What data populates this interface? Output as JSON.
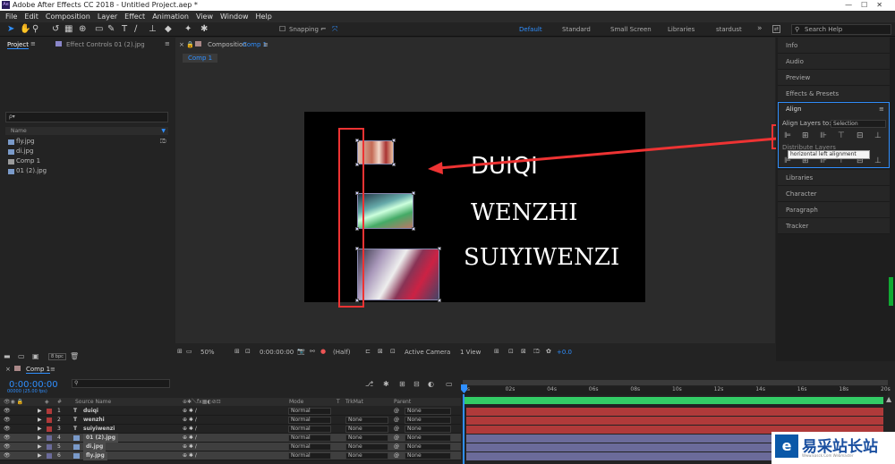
{
  "app": {
    "title": "Adobe After Effects CC 2018 - Untitled Project.aep *",
    "icon": "Ae"
  },
  "menu": [
    "File",
    "Edit",
    "Composition",
    "Layer",
    "Effect",
    "Animation",
    "View",
    "Window",
    "Help"
  ],
  "toolbar": {
    "snapping": "Snapping",
    "workspaces": [
      "Default",
      "Standard",
      "Small Screen",
      "Libraries",
      "stardust"
    ],
    "search_placeholder": "Search Help"
  },
  "project": {
    "tab": "Project",
    "effect_tab": "Effect Controls 01 (2).jpg",
    "search_placeholder": "ρ▾",
    "name_header": "Name",
    "bpc": "8 bpc",
    "items": [
      {
        "name": "fly.jpg",
        "type": "image"
      },
      {
        "name": "di.jpg",
        "type": "image"
      },
      {
        "name": "Comp 1",
        "type": "comp"
      },
      {
        "name": "01 (2).jpg",
        "type": "image"
      }
    ]
  },
  "composition": {
    "tab_prefix": "Composition",
    "tab_name": "Comp 1",
    "flow_tab": "Comp 1",
    "texts": [
      "DUIQI",
      "WENZHI",
      "SUIYIWENZI"
    ],
    "footer": {
      "zoom": "50%",
      "timecode": "0:00:00:00",
      "resolution": "(Half)",
      "camera": "Active Camera",
      "view": "1 View",
      "exposure": "+0.0"
    }
  },
  "right_panels": [
    "Info",
    "Audio",
    "Preview",
    "Effects & Presets",
    "Align",
    "Libraries",
    "Character",
    "Paragraph",
    "Tracker"
  ],
  "align": {
    "title": "Align",
    "align_layers_to": "Align Layers to:",
    "selection": "Selection",
    "distribute": "Distribute Layers",
    "tooltip": "horizontal left alignment"
  },
  "timeline": {
    "tab": "Comp 1",
    "timecode": "0:00:00:00",
    "fps": "00000 (25.00 fps)",
    "columns": {
      "num": "#",
      "source": "Source Name",
      "mode": "Mode",
      "t": "T",
      "trkmat": "TrkMat",
      "parent": "Parent"
    },
    "ruler": [
      "0s",
      "02s",
      "04s",
      "06s",
      "08s",
      "10s",
      "12s",
      "14s",
      "16s",
      "18s",
      "20s"
    ],
    "layers": [
      {
        "num": "1",
        "type": "T",
        "name": "duiqi",
        "mode": "Normal",
        "trkmat": "",
        "parent": "None",
        "color": "#b03a3a"
      },
      {
        "num": "2",
        "type": "T",
        "name": "wenzhi",
        "mode": "Normal",
        "trkmat": "None",
        "parent": "None",
        "color": "#b03a3a"
      },
      {
        "num": "3",
        "type": "T",
        "name": "suiyiwenzi",
        "mode": "Normal",
        "trkmat": "None",
        "parent": "None",
        "color": "#b03a3a"
      },
      {
        "num": "4",
        "type": "img",
        "name": "01 (2).jpg",
        "mode": "Normal",
        "trkmat": "None",
        "parent": "None",
        "color": "#6b6b9a"
      },
      {
        "num": "5",
        "type": "img",
        "name": "di.jpg",
        "mode": "Normal",
        "trkmat": "None",
        "parent": "None",
        "color": "#6b6b9a"
      },
      {
        "num": "6",
        "type": "img",
        "name": "fly.jpg",
        "mode": "Normal",
        "trkmat": "None",
        "parent": "None",
        "color": "#6b6b9a"
      }
    ]
  },
  "watermark": {
    "text": "易采站长站",
    "sub": "Www.Easck.Com Webmaster"
  }
}
